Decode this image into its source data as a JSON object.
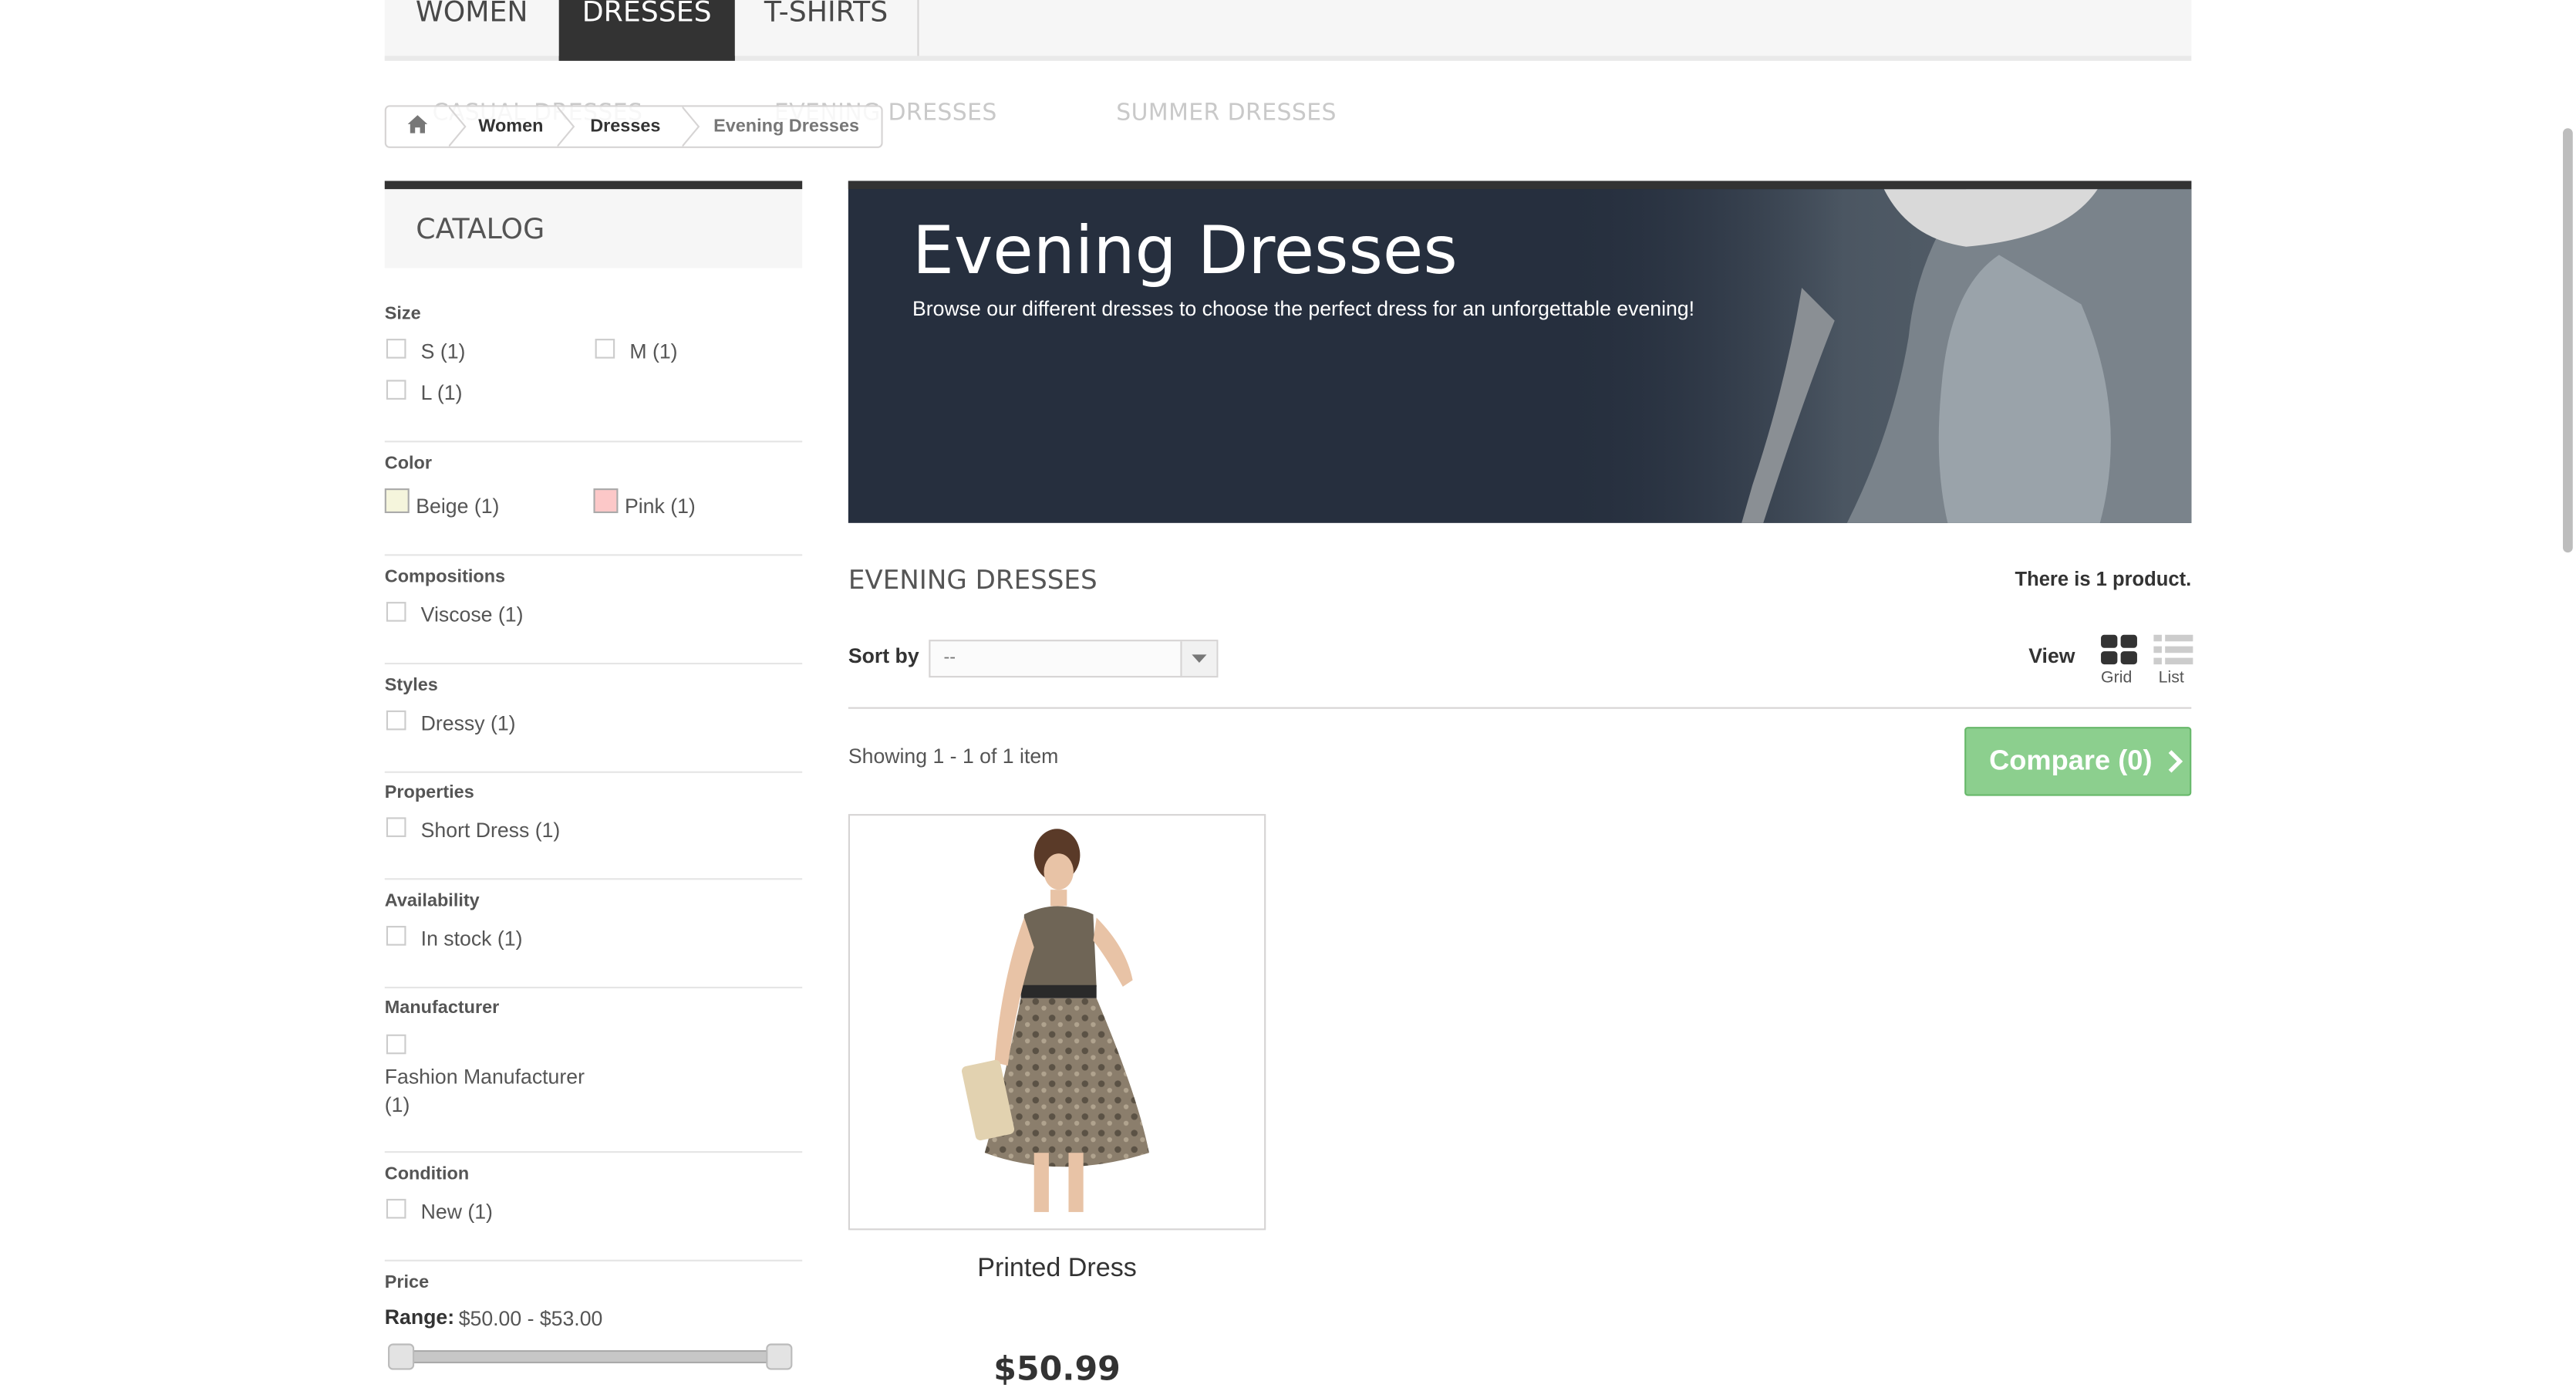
{
  "topnav": {
    "tabs": [
      "WOMEN",
      "DRESSES",
      "T-SHIRTS"
    ],
    "active_tab": "DRESSES"
  },
  "submenu": {
    "items": [
      "CASUAL DRESSES",
      "EVENING DRESSES",
      "SUMMER DRESSES"
    ]
  },
  "breadcrumb": {
    "items": [
      "Women",
      "Dresses"
    ],
    "current": "Evening Dresses",
    "home_icon": "home-icon"
  },
  "sidebar": {
    "title": "CATALOG",
    "filters": {
      "size": {
        "title": "Size",
        "options": [
          "S (1)",
          "M (1)",
          "L (1)"
        ]
      },
      "color": {
        "title": "Color",
        "options": [
          {
            "label": "Beige (1)",
            "color": "#f5f5dc"
          },
          {
            "label": "Pink (1)",
            "color": "#fcc8c8"
          }
        ]
      },
      "compositions": {
        "title": "Compositions",
        "options": [
          "Viscose (1)"
        ]
      },
      "styles": {
        "title": "Styles",
        "options": [
          "Dressy (1)"
        ]
      },
      "properties": {
        "title": "Properties",
        "options": [
          "Short Dress (1)"
        ]
      },
      "availability": {
        "title": "Availability",
        "options": [
          "In stock (1)"
        ]
      },
      "manufacturer": {
        "title": "Manufacturer",
        "options": [
          "Fashion Manufacturer",
          "(1)"
        ]
      },
      "condition": {
        "title": "Condition",
        "options": [
          "New (1)"
        ]
      },
      "price": {
        "title": "Price",
        "range_label": "Range:",
        "range_value": "$50.00 - $53.00",
        "min": 50.0,
        "max": 53.0
      }
    }
  },
  "banner": {
    "title": "Evening Dresses",
    "description": "Browse our different dresses to choose the perfect dress for an unforgettable evening!"
  },
  "listing": {
    "heading": "EVENING DRESSES",
    "count_text": "There is 1 product.",
    "sort_label": "Sort by",
    "sort_value": "--",
    "view_label": "View",
    "view_grid": "Grid",
    "view_list": "List",
    "showing": "Showing 1 - 1 of 1 item",
    "compare_label": "Compare (0)"
  },
  "product": {
    "name": "Printed Dress",
    "price": "$50.99"
  },
  "colors": {
    "accent_green": "#8ccf8e",
    "dark": "#333333",
    "banner_bg": "#262f3e"
  }
}
